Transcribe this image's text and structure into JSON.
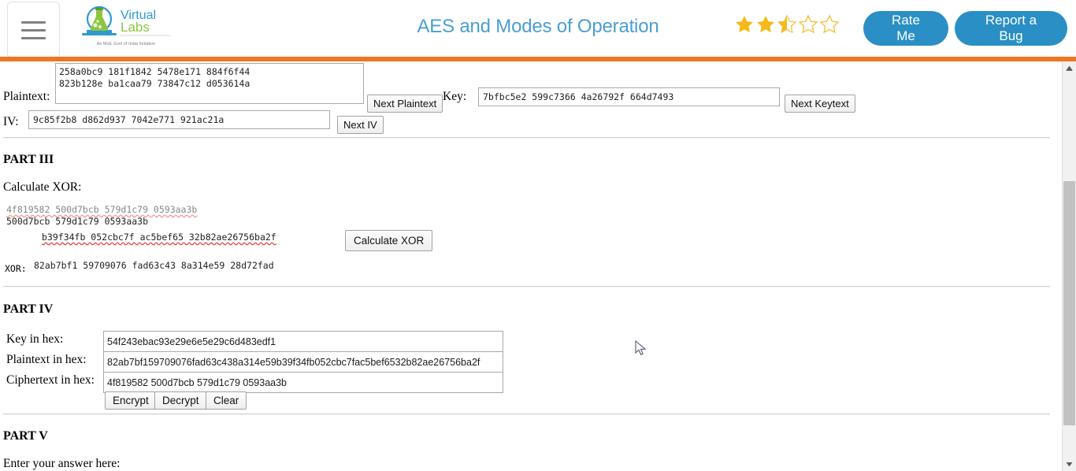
{
  "header": {
    "menu_icon": "hamburger-menu-icon",
    "logo": {
      "name_part1": "Virtual",
      "name_part2": "Labs",
      "tagline": "An MoE Govt of India Initiative"
    },
    "title": "AES and Modes of Operation",
    "title_color": "#4a9ed0",
    "rating": {
      "value": 2.5,
      "max": 5,
      "filled_color": "#f5b919",
      "empty_color": "#f3c23d"
    },
    "rate_me_label": "Rate Me",
    "report_bug_label": "Report a Bug",
    "button_color": "#2a8fc4",
    "accent_bar_color": "#ef7622"
  },
  "part2": {
    "plaintext_label": "Plaintext:",
    "plaintext_value_line1": "258a0bc9 181f1842 5478e171 884f6f44",
    "plaintext_value_line2": "823b128e ba1caa79 73847c12 d053614a",
    "next_plaintext_label": "Next Plaintext",
    "key_label": "Key:",
    "key_value": "7bfbc5e2 599c7366 4a26792f 664d7493",
    "next_keytext_label": "Next Keytext",
    "iv_label": "IV:",
    "iv_value": "9c85f2b8 d862d937 7042e771 921ac21a",
    "next_iv_label": "Next IV"
  },
  "part3": {
    "heading": "PART III",
    "calculate_xor_label": "Calculate XOR:",
    "input1_visible_line": "500d7bcb 579d1c79 0593aa3b",
    "input1_clipped_line": "4f819582 500d7bcb 579d1c79 0593aa3b",
    "input2_value": "b39f34fb 052cbc7f ac5bef65 32b82ae26756ba2f",
    "calculate_button_label": "Calculate XOR",
    "xor_label": "XOR:",
    "xor_value": "82ab7bf1 59709076 fad63c43 8a314e59 28d72fad"
  },
  "part4": {
    "heading": "PART IV",
    "fields": [
      {
        "label": "Key in hex:",
        "value": "54f243ebac93e29e6e5e29c6d483edf1"
      },
      {
        "label": "Plaintext in hex:",
        "value": "82ab7bf159709076fad63c438a314e59b39f34fb052cbc7fac5bef6532b82ae26756ba2f"
      },
      {
        "label": "Ciphertext in hex:",
        "value": "4f819582 500d7bcb 579d1c79 0593aa3b"
      }
    ],
    "encrypt_label": "Encrypt",
    "decrypt_label": "Decrypt",
    "clear_label": "Clear"
  },
  "part5": {
    "heading": "PART V",
    "prompt": "Enter your answer here:"
  },
  "scrollbar": {
    "up_arrow": "scroll-up-arrow-icon",
    "down_arrow": "scroll-down-arrow-icon"
  }
}
